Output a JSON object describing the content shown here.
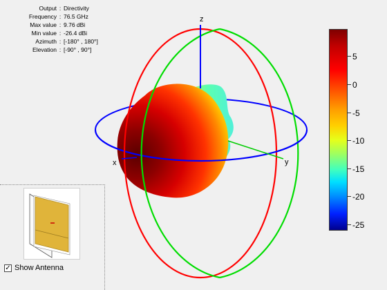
{
  "info": {
    "rows": [
      {
        "key": "Output",
        "value": "Directivity"
      },
      {
        "key": "Frequency",
        "value": "76.5 GHz"
      },
      {
        "key": "Max value",
        "value": "9.76 dBi"
      },
      {
        "key": "Min value",
        "value": "-26.4 dBi"
      },
      {
        "key": "Azimuth",
        "value": "[-180° , 180°]"
      },
      {
        "key": "Elevation",
        "value": "[-90° , 90°]"
      }
    ],
    "separator": ":"
  },
  "axes": {
    "x": "x",
    "y": "y",
    "z": "z"
  },
  "colorbar": {
    "ticks": [
      {
        "label": "5",
        "value": 5
      },
      {
        "label": "0",
        "value": 0
      },
      {
        "label": "-5",
        "value": -5
      },
      {
        "label": "-10",
        "value": -10
      },
      {
        "label": "-15",
        "value": -15
      },
      {
        "label": "-20",
        "value": -20
      },
      {
        "label": "-25",
        "value": -25
      }
    ],
    "max": 9.76,
    "min": -26.4
  },
  "antenna": {
    "show_label": "Show Antenna",
    "checked": true,
    "check_glyph": "✓"
  },
  "colors": {
    "azimuth_ring": "#0000ff",
    "elevation_ring_red": "#ff0000",
    "elevation_ring_green": "#00e000",
    "patch": "#e0b43a"
  }
}
